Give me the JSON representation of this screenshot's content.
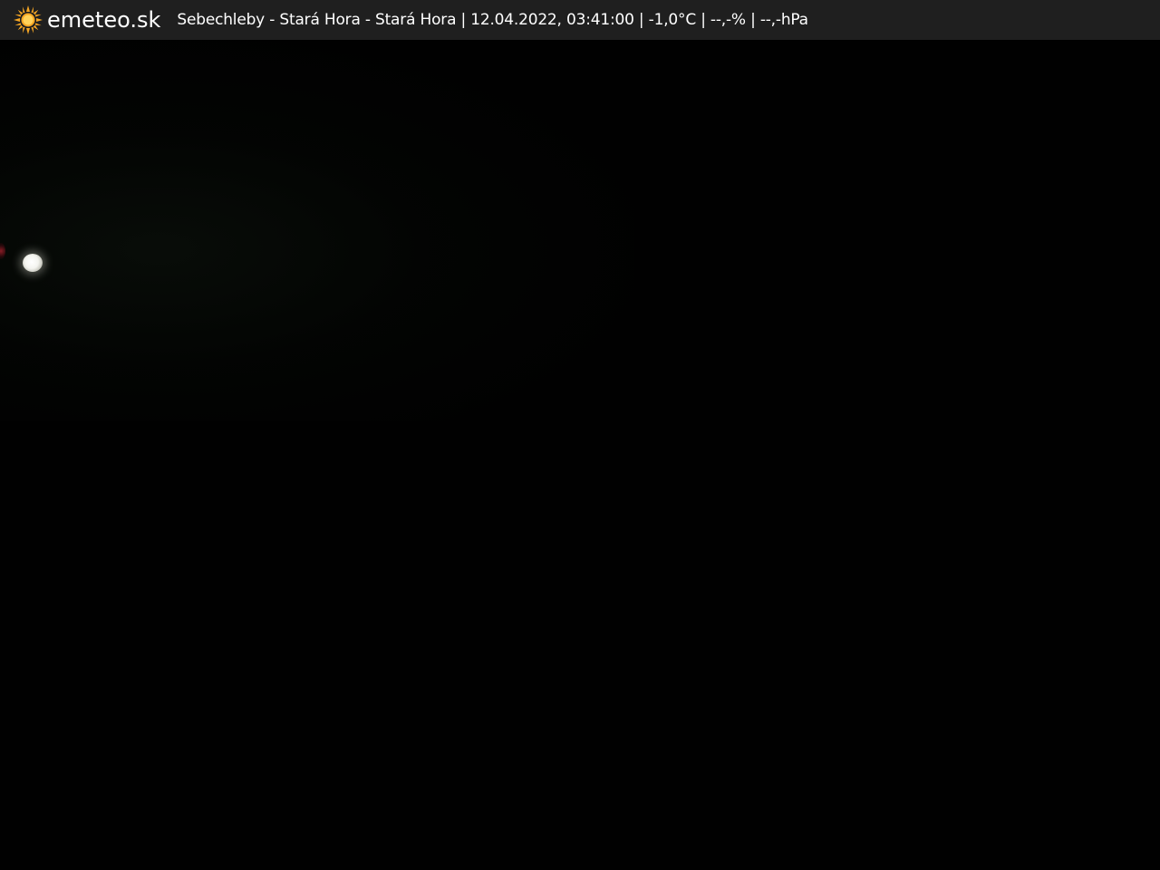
{
  "header": {
    "brand": "emeteo.sk",
    "caption": "Sebechleby - Stará Hora - Stará Hora | 12.04.2022, 03:41:00 | -1,0°C | --,-% | --,-hPa",
    "logo_icon": "sun-icon",
    "background_color": "#1f1f1f",
    "sun_color": "#f5a623"
  },
  "camera": {
    "background_color": "#010101"
  }
}
